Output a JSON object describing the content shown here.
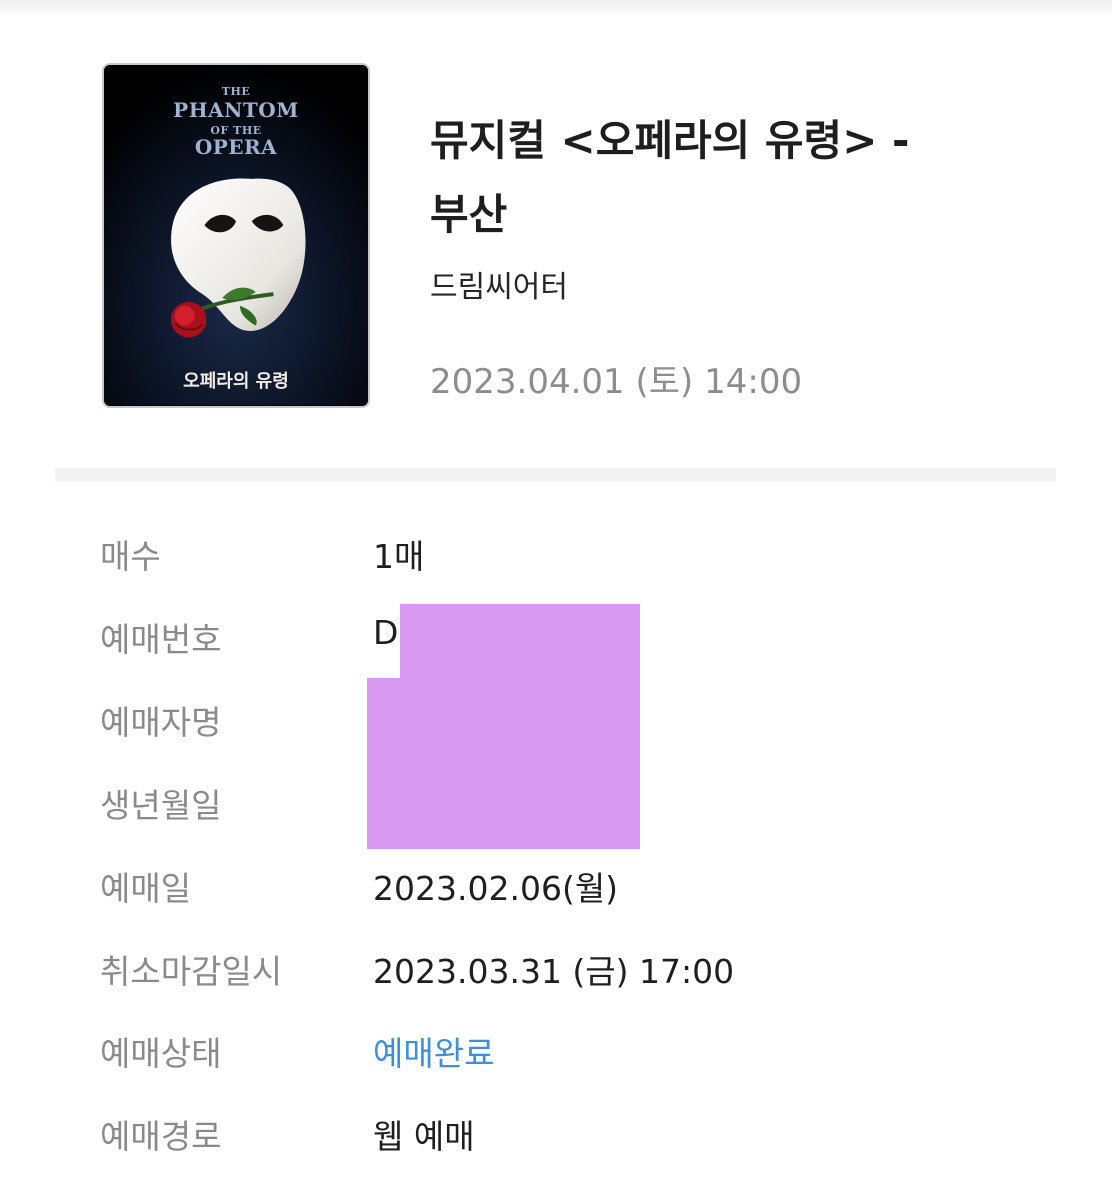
{
  "poster": {
    "title_the": "THE",
    "title_phantom": "PHANTOM",
    "title_of_the": "OF THE",
    "title_opera": "OPERA",
    "korean_title": "오페라의 유령"
  },
  "header": {
    "title": "뮤지컬 <오페라의 유령> - 부산",
    "venue": "드림씨어터",
    "datetime": "2023.04.01 (토) 14:00"
  },
  "details": [
    {
      "label": "매수",
      "value": "1매"
    },
    {
      "label": "예매번호",
      "value": "D"
    },
    {
      "label": "예매자명",
      "value": ""
    },
    {
      "label": "생년월일",
      "value": ""
    },
    {
      "label": "예매일",
      "value": "2023.02.06(월)"
    },
    {
      "label": "취소마감일시",
      "value": "2023.03.31 (금) 17:00"
    },
    {
      "label": "예매상태",
      "value": "예매완료"
    },
    {
      "label": "예매경로",
      "value": "웹 예매"
    }
  ],
  "colors": {
    "status_blue": "#3f8fdb",
    "redaction": "#d899f3",
    "label_gray": "#8a8a8a"
  }
}
